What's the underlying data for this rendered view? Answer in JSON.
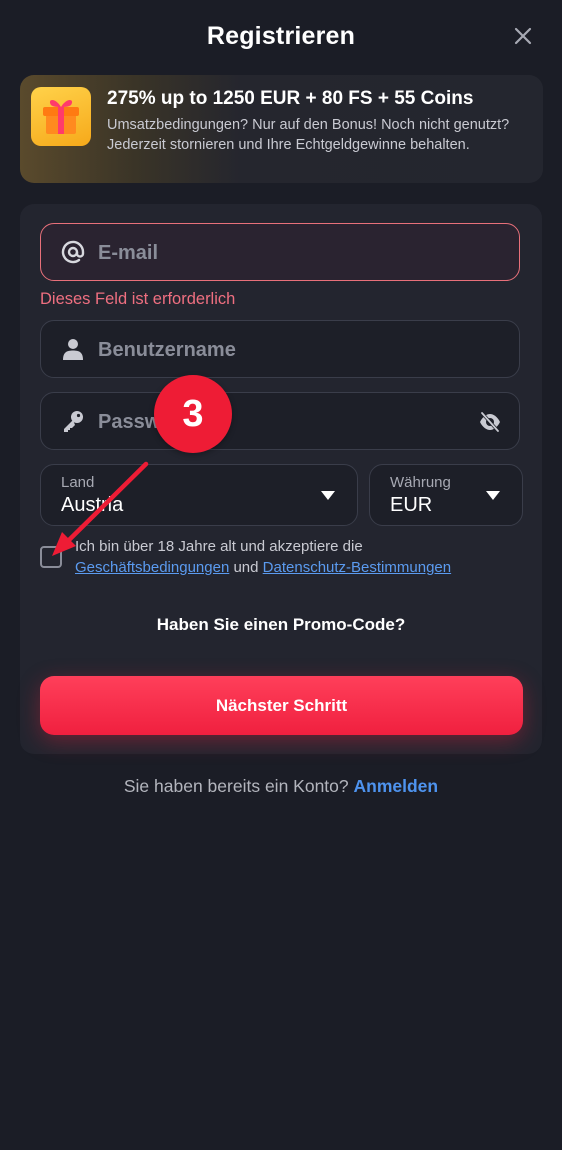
{
  "header": {
    "title": "Registrieren",
    "close_icon": "close-icon"
  },
  "bonus": {
    "icon": "gift-icon",
    "title": "275% up to 1250 EUR + 80 FS + 55 Coins",
    "description": "Umsatzbedingungen? Nur auf den Bonus! Noch nicht genutzt? Jederzeit stornieren und Ihre Echtgeldgewinne behalten."
  },
  "form": {
    "email": {
      "placeholder": "E-mail",
      "value": "",
      "icon": "at-icon",
      "error": "Dieses Feld ist erforderlich"
    },
    "username": {
      "placeholder": "Benutzername",
      "value": "",
      "icon": "user-icon"
    },
    "password": {
      "placeholder": "Passwort",
      "value": "",
      "icon": "key-icon",
      "toggle_icon": "eye-off-icon"
    },
    "country": {
      "label": "Land",
      "value": "Austria"
    },
    "currency": {
      "label": "Währung",
      "value": "EUR"
    },
    "terms": {
      "checked": false,
      "text": "Ich bin über 18 Jahre alt und akzeptiere die",
      "link1": "Geschäftsbedingungen",
      "conjunction": "und",
      "link2": "Datenschutz-Bestimmungen"
    },
    "promo_label": "Haben Sie einen Promo-Code?",
    "next_button": "Nächster Schritt"
  },
  "footer": {
    "question": "Sie haben bereits ein Konto?",
    "login_link": "Anmelden"
  },
  "annotation": {
    "step_number": "3",
    "color": "#ee1c35"
  },
  "colors": {
    "accent": "#f0203f",
    "link": "#4e93ee",
    "error": "#ee6f80",
    "background": "#1b1d26"
  }
}
